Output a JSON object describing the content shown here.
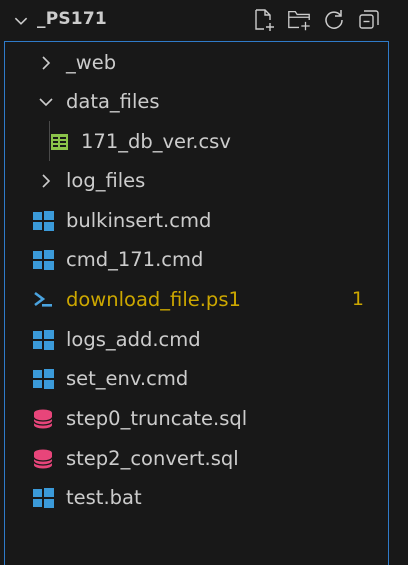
{
  "explorer": {
    "root_name": "_PS171",
    "actions": [
      {
        "name": "new-file-button",
        "icon": "new-file-icon"
      },
      {
        "name": "new-folder-button",
        "icon": "new-folder-icon"
      },
      {
        "name": "refresh-button",
        "icon": "refresh-icon"
      },
      {
        "name": "collapse-all-button",
        "icon": "collapse-all-icon"
      }
    ],
    "items": [
      {
        "label": "_web",
        "type": "folder",
        "expanded": false,
        "depth": 1
      },
      {
        "label": "data_files",
        "type": "folder",
        "expanded": true,
        "depth": 1
      },
      {
        "label": "171_db_ver.csv",
        "type": "csv-file",
        "depth": 2
      },
      {
        "label": "log_files",
        "type": "folder",
        "expanded": false,
        "depth": 1
      },
      {
        "label": "bulkinsert.cmd",
        "type": "windows-cmd-file",
        "depth": 1
      },
      {
        "label": "cmd_171.cmd",
        "type": "windows-cmd-file",
        "depth": 1
      },
      {
        "label": "download_file.ps1",
        "type": "powershell-file",
        "depth": 1,
        "badge": "1",
        "status": "modified"
      },
      {
        "label": "logs_add.cmd",
        "type": "windows-cmd-file",
        "depth": 1
      },
      {
        "label": "set_env.cmd",
        "type": "windows-cmd-file",
        "depth": 1
      },
      {
        "label": "step0_truncate.sql",
        "type": "sql-file",
        "depth": 1
      },
      {
        "label": "step2_convert.sql",
        "type": "sql-file",
        "depth": 1
      },
      {
        "label": "test.bat",
        "type": "windows-cmd-file",
        "depth": 1
      }
    ]
  },
  "colors": {
    "background": "#181818",
    "text": "#cccccc",
    "focus_border": "#2f7bc9",
    "modified": "#cca700",
    "windows_icon": "#3b9ad9",
    "powershell_icon": "#4aa3df",
    "sql_icon": "#e8457a",
    "csv_icon": "#8bc34a"
  }
}
